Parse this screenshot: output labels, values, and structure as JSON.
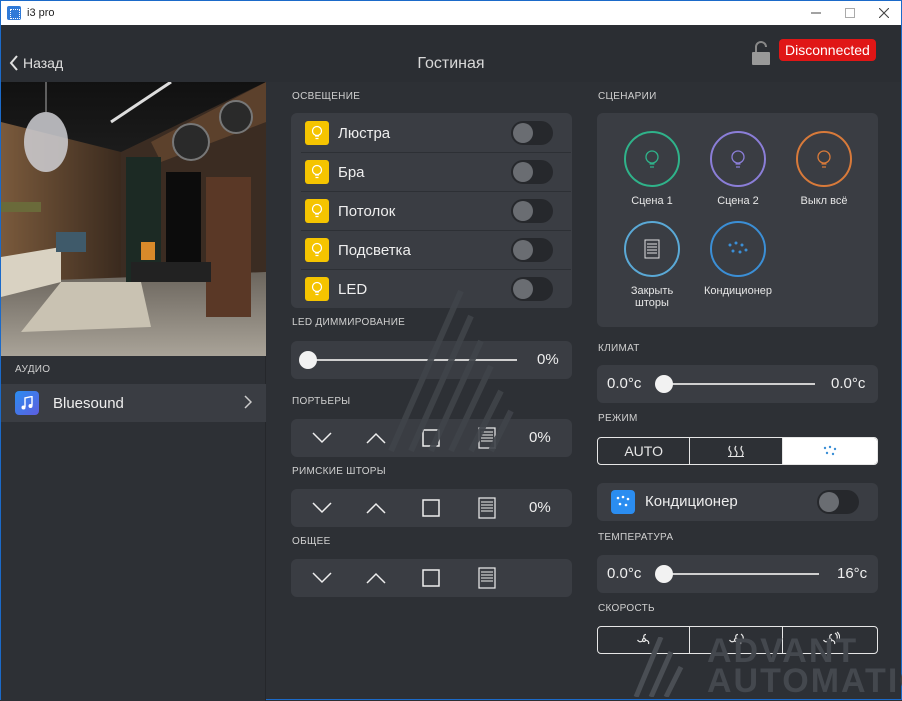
{
  "window": {
    "title": "i3 pro"
  },
  "header": {
    "back_label": "Назад",
    "title": "Гостиная",
    "status": "Disconnected"
  },
  "audio": {
    "section": "АУДИО",
    "item": "Bluesound"
  },
  "lighting": {
    "section": "ОСВЕЩЕНИЕ",
    "items": [
      {
        "label": "Люстра",
        "on": false
      },
      {
        "label": "Бра",
        "on": false
      },
      {
        "label": "Потолок",
        "on": false
      },
      {
        "label": "Подсветка",
        "on": false
      },
      {
        "label": "LED",
        "on": false
      }
    ]
  },
  "led_dimming": {
    "section": "LED ДИММИРОВАНИЕ",
    "value": "0%"
  },
  "curtains": {
    "section": "ПОРТЬЕРЫ",
    "value": "0%"
  },
  "roman": {
    "section": "РИМСКИЕ ШТОРЫ",
    "value": "0%"
  },
  "general": {
    "section": "ОБЩЕЕ"
  },
  "scenes": {
    "section": "СЦЕНАРИИ",
    "items": [
      {
        "label": "Сцена 1",
        "color": "#2fb38a"
      },
      {
        "label": "Сцена 2",
        "color": "#8b7ed8"
      },
      {
        "label": "Выкл всё",
        "color": "#d87a3a"
      },
      {
        "label": "Закрыть шторы",
        "color": "#5aa9d6"
      },
      {
        "label": "Кондиционер",
        "color": "#3b8fd6"
      }
    ]
  },
  "climate": {
    "section": "КЛИМАТ",
    "current": "0.0°c",
    "target": "0.0°c"
  },
  "mode": {
    "section": "РЕЖИМ",
    "options": [
      "AUTO",
      "heat",
      "cool"
    ],
    "selected": "cool"
  },
  "ac": {
    "label": "Кондиционер",
    "on": false
  },
  "temperature": {
    "section": "ТЕМПЕРАТУРА",
    "current": "0.0°c",
    "setpoint": "16°c"
  },
  "speed": {
    "section": "СКОРОСТЬ",
    "options": [
      "fan-low",
      "fan-mid",
      "fan-high"
    ]
  },
  "watermark": {
    "line1": "ADVANT",
    "line2": "AUTOMATIC"
  },
  "colors": {
    "status_red": "#e01616",
    "bulb_yellow": "#f5c400",
    "accent_blue": "#2b8df0"
  }
}
